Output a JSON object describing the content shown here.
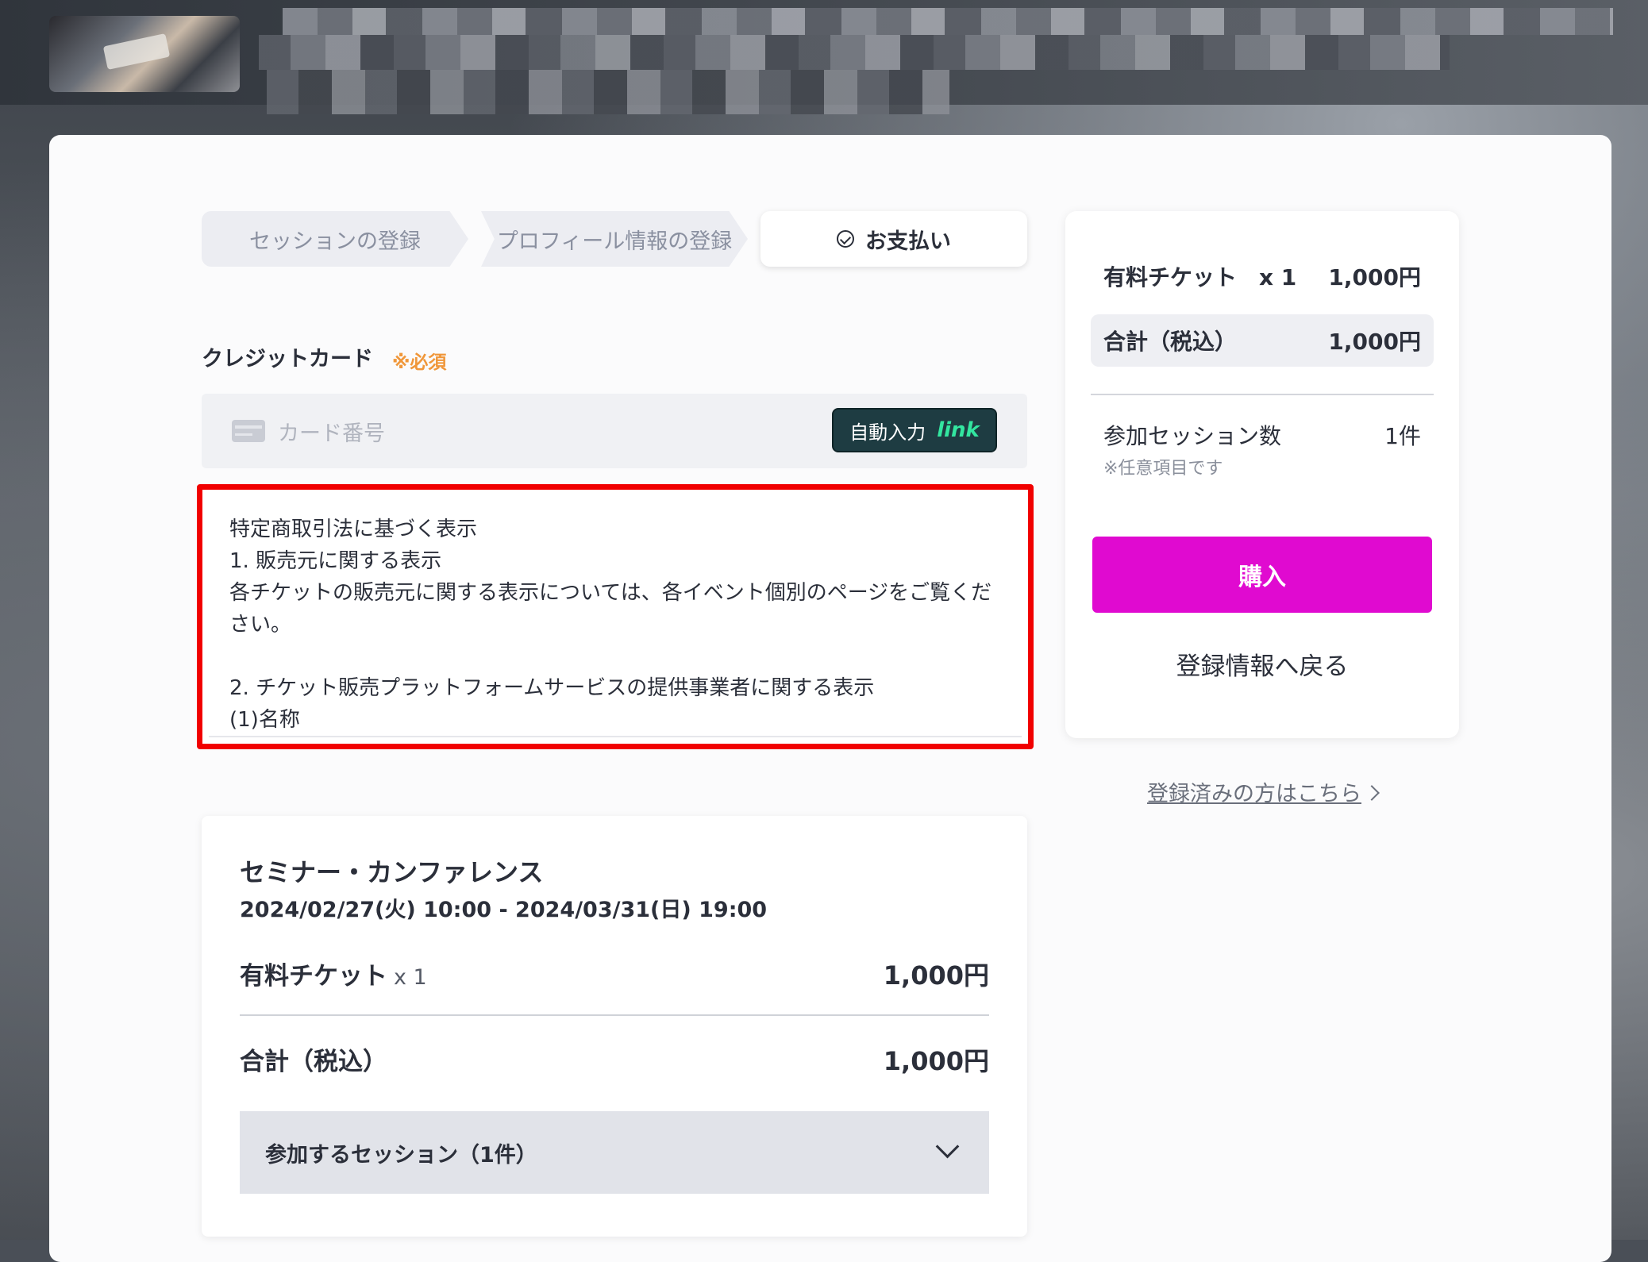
{
  "steps": [
    {
      "label": "セッションの登録"
    },
    {
      "label": "プロフィール情報の登録"
    },
    {
      "label": "お支払い"
    }
  ],
  "payment": {
    "credit_card_label": "クレジットカード",
    "required_label": "※必須",
    "card_number_placeholder": "カード番号",
    "autofill_label": "自動入力",
    "link_logo": "link"
  },
  "legal_notice": {
    "lines": [
      "特定商取引法に基づく表示",
      "1. 販売元に関する表示",
      "各チケットの販売元に関する表示については、各イベント個別のページをご覧ください。",
      "",
      "2. チケット販売プラットフォームサービスの提供事業者に関する表示",
      "(1)名称"
    ]
  },
  "event": {
    "title": "セミナー・カンファレンス",
    "date": "2024/02/27(火) 10:00 - 2024/03/31(日) 19:00",
    "ticket_label": "有料チケット",
    "ticket_qty": "x 1",
    "ticket_price": "1,000円",
    "total_label": "合計（税込）",
    "total_price": "1,000円",
    "sessions_toggle": "参加するセッション（1件）"
  },
  "sidebar": {
    "ticket_label": "有料チケット　x 1",
    "ticket_price": "1,000円",
    "total_label": "合計（税込）",
    "total_price": "1,000円",
    "session_count_label": "参加セッション数",
    "session_count_value": "1件",
    "optional_note": "※任意項目です",
    "buy_label": "購入",
    "back_label": "登録情報へ戻る"
  },
  "registered_link": "登録済みの方はこちら",
  "colors": {
    "buy_button": "#e00ad0",
    "required": "#f0973a",
    "highlight_border": "#f10000",
    "link_green": "#33e6a0"
  }
}
